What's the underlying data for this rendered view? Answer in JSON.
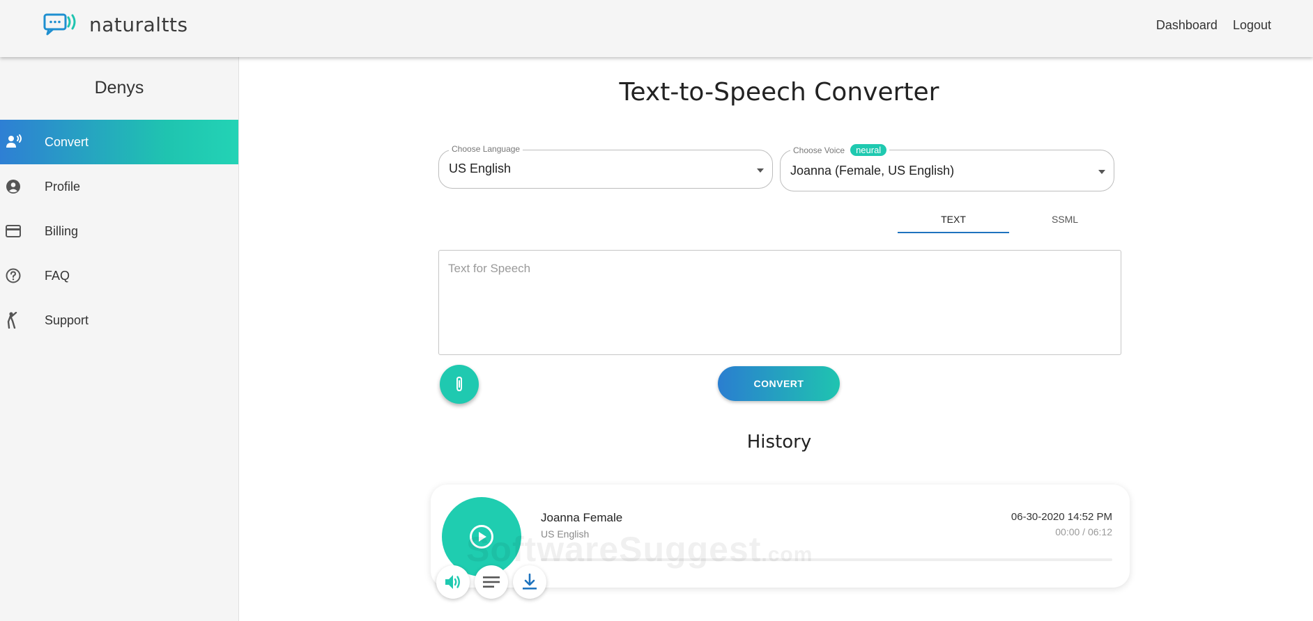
{
  "header": {
    "logo_text": "naturaltts",
    "nav": {
      "dashboard": "Dashboard",
      "logout": "Logout"
    }
  },
  "sidebar": {
    "username": "Denys",
    "items": [
      {
        "label": "Convert",
        "icon": "voice-icon",
        "active": true
      },
      {
        "label": "Profile",
        "icon": "user-icon",
        "active": false
      },
      {
        "label": "Billing",
        "icon": "credit-card-icon",
        "active": false
      },
      {
        "label": "FAQ",
        "icon": "help-icon",
        "active": false
      },
      {
        "label": "Support",
        "icon": "person-icon",
        "active": false
      }
    ]
  },
  "main": {
    "title": "Text-to-Speech Converter",
    "language": {
      "label": "Choose Language",
      "value": "US English"
    },
    "voice": {
      "label": "Choose Voice",
      "badge": "neural",
      "value": "Joanna (Female, US English)"
    },
    "tabs": [
      {
        "label": "TEXT",
        "active": true
      },
      {
        "label": "SSML",
        "active": false
      }
    ],
    "textarea": {
      "placeholder": "Text for Speech",
      "value": ""
    },
    "convert_label": "CONVERT",
    "history_title": "History"
  },
  "history": [
    {
      "name": "Joanna Female",
      "language": "US English",
      "date": "06-30-2020 14:52 PM",
      "time": "00:00 / 06:12",
      "progress": 0
    }
  ],
  "watermark": {
    "main": "SoftwareSuggest",
    "suffix": ".com"
  },
  "colors": {
    "accent": "#1fc9b0",
    "primary": "#2e7fd4"
  }
}
